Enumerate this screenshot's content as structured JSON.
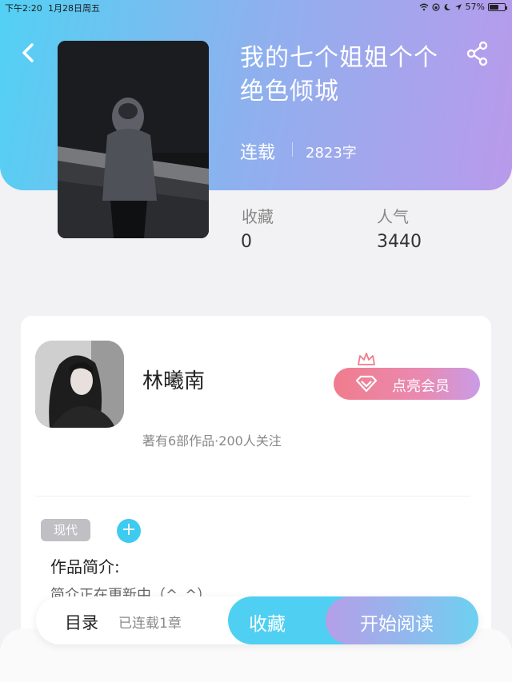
{
  "status_bar": {
    "time": "下午2:20",
    "date": "1月28日周五",
    "battery": "57%"
  },
  "header": {
    "back_icon": "chevron-left-icon",
    "share_icon": "share-icon"
  },
  "book": {
    "title_line1": "我的七个姐姐个个",
    "title_line2": "绝色倾城",
    "status": "连载",
    "word_count": "2823字",
    "stats": {
      "favorites_label": "收藏",
      "favorites_value": "0",
      "popularity_label": "人气",
      "popularity_value": "3440"
    }
  },
  "author": {
    "name": "林曦南",
    "meta": "著有6部作品·200人关注",
    "vip_button_label": "点亮会员",
    "vip_icon": "diamond-icon",
    "crown_icon": "crown-icon"
  },
  "tags": {
    "items": [
      "现代"
    ],
    "add_label": "+"
  },
  "intro": {
    "title": "作品简介:",
    "text": "简介正在更新中（^_^）"
  },
  "bottom_bar": {
    "toc_label": "目录",
    "toc_sub": "已连载1章",
    "favorite_button": "收藏",
    "read_button": "开始阅读"
  },
  "colors": {
    "header_gradient_start": "#52d1f4",
    "header_gradient_end": "#b99aeb",
    "accent_cyan": "#4fd0f2",
    "vip_pink": "#f07c8c"
  }
}
